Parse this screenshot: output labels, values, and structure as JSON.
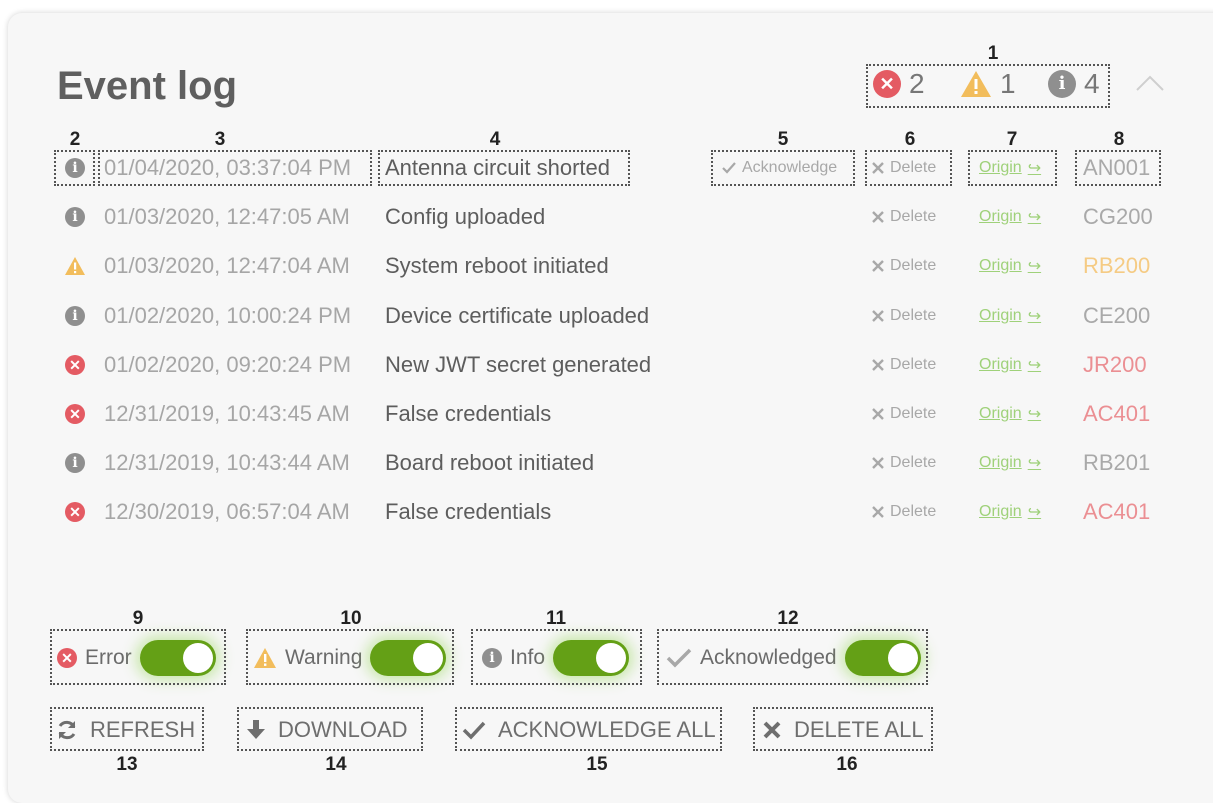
{
  "title": "Event log",
  "summary": {
    "errors": "2",
    "warnings": "1",
    "infos": "4"
  },
  "columns": {
    "acknowledge_label": "Acknowledge",
    "delete_label": "Delete",
    "origin_label": "Origin"
  },
  "events": [
    {
      "severity": "info",
      "timestamp": "01/04/2020, 03:37:04 PM",
      "message": "Antenna circuit shorted",
      "code": "AN001",
      "acknowledge": true
    },
    {
      "severity": "info",
      "timestamp": "01/03/2020, 12:47:05 AM",
      "message": "Config uploaded",
      "code": "CG200",
      "acknowledge": false
    },
    {
      "severity": "warning",
      "timestamp": "01/03/2020, 12:47:04 AM",
      "message": "System reboot initiated",
      "code": "RB200",
      "acknowledge": false
    },
    {
      "severity": "info",
      "timestamp": "01/02/2020, 10:00:24 PM",
      "message": "Device certificate uploaded",
      "code": "CE200",
      "acknowledge": false
    },
    {
      "severity": "error",
      "timestamp": "01/02/2020, 09:20:24 PM",
      "message": "New JWT secret generated",
      "code": "JR200",
      "acknowledge": false
    },
    {
      "severity": "error",
      "timestamp": "12/31/2019, 10:43:45 AM",
      "message": "False credentials",
      "code": "AC401",
      "acknowledge": false
    },
    {
      "severity": "info",
      "timestamp": "12/31/2019, 10:43:44 AM",
      "message": "Board reboot initiated",
      "code": "RB201",
      "acknowledge": false
    },
    {
      "severity": "error",
      "timestamp": "12/30/2019, 06:57:04 AM",
      "message": "False credentials",
      "code": "AC401",
      "acknowledge": false
    }
  ],
  "filters": {
    "error": {
      "label": "Error",
      "on": true
    },
    "warning": {
      "label": "Warning",
      "on": true
    },
    "info": {
      "label": "Info",
      "on": true
    },
    "acknowledged": {
      "label": "Acknowledged",
      "on": true
    }
  },
  "actions": {
    "refresh": "REFRESH",
    "download": "DOWNLOAD",
    "acknowledge_all": "ACKNOWLEDGE ALL",
    "delete_all": "DELETE ALL"
  },
  "annotations": [
    "1",
    "2",
    "3",
    "4",
    "5",
    "6",
    "7",
    "8",
    "9",
    "10",
    "11",
    "12",
    "13",
    "14",
    "15",
    "16"
  ],
  "colors": {
    "error": "#e45b63",
    "warning": "#f2bd5c",
    "info": "#8f8f8f",
    "toggle_on": "#64a016",
    "origin_link": "#9fd17a"
  }
}
